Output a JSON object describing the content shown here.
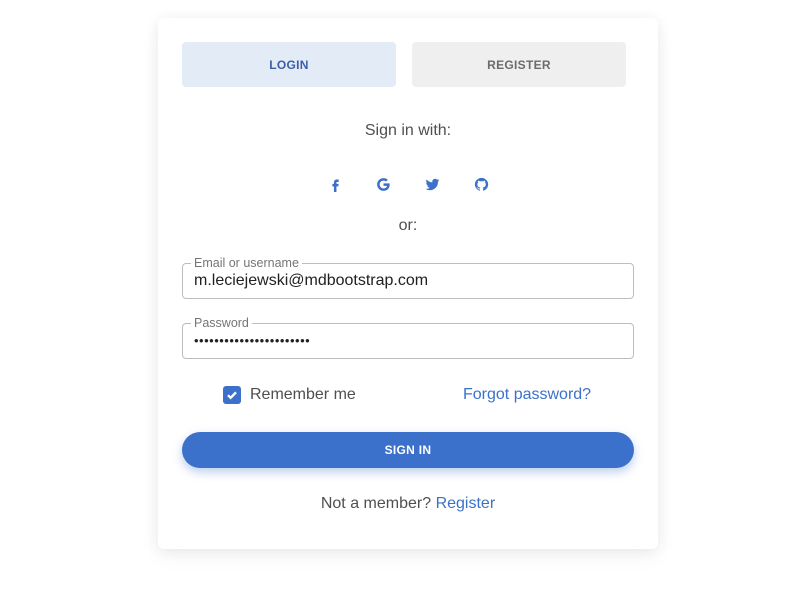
{
  "tabs": {
    "login_label": "LOGIN",
    "register_label": "REGISTER",
    "active": "login"
  },
  "social": {
    "heading": "Sign in with:",
    "icons": [
      "facebook-icon",
      "google-icon",
      "twitter-icon",
      "github-icon"
    ]
  },
  "divider_text": "or:",
  "form": {
    "email": {
      "label": "Email or username",
      "value": "m.leciejewski@mdbootstrap.com"
    },
    "password": {
      "label": "Password",
      "value": "•••••••••••••••••••••••"
    },
    "remember": {
      "label": "Remember me",
      "checked": true
    },
    "forgot_label": "Forgot password?",
    "submit_label": "SIGN IN"
  },
  "footer": {
    "text": "Not a member?",
    "link_label": "Register"
  },
  "colors": {
    "primary": "#3b71ca",
    "tab_active_bg": "#e3ebf7",
    "tab_inactive_bg": "#efefef",
    "text": "#4f4f4f"
  }
}
